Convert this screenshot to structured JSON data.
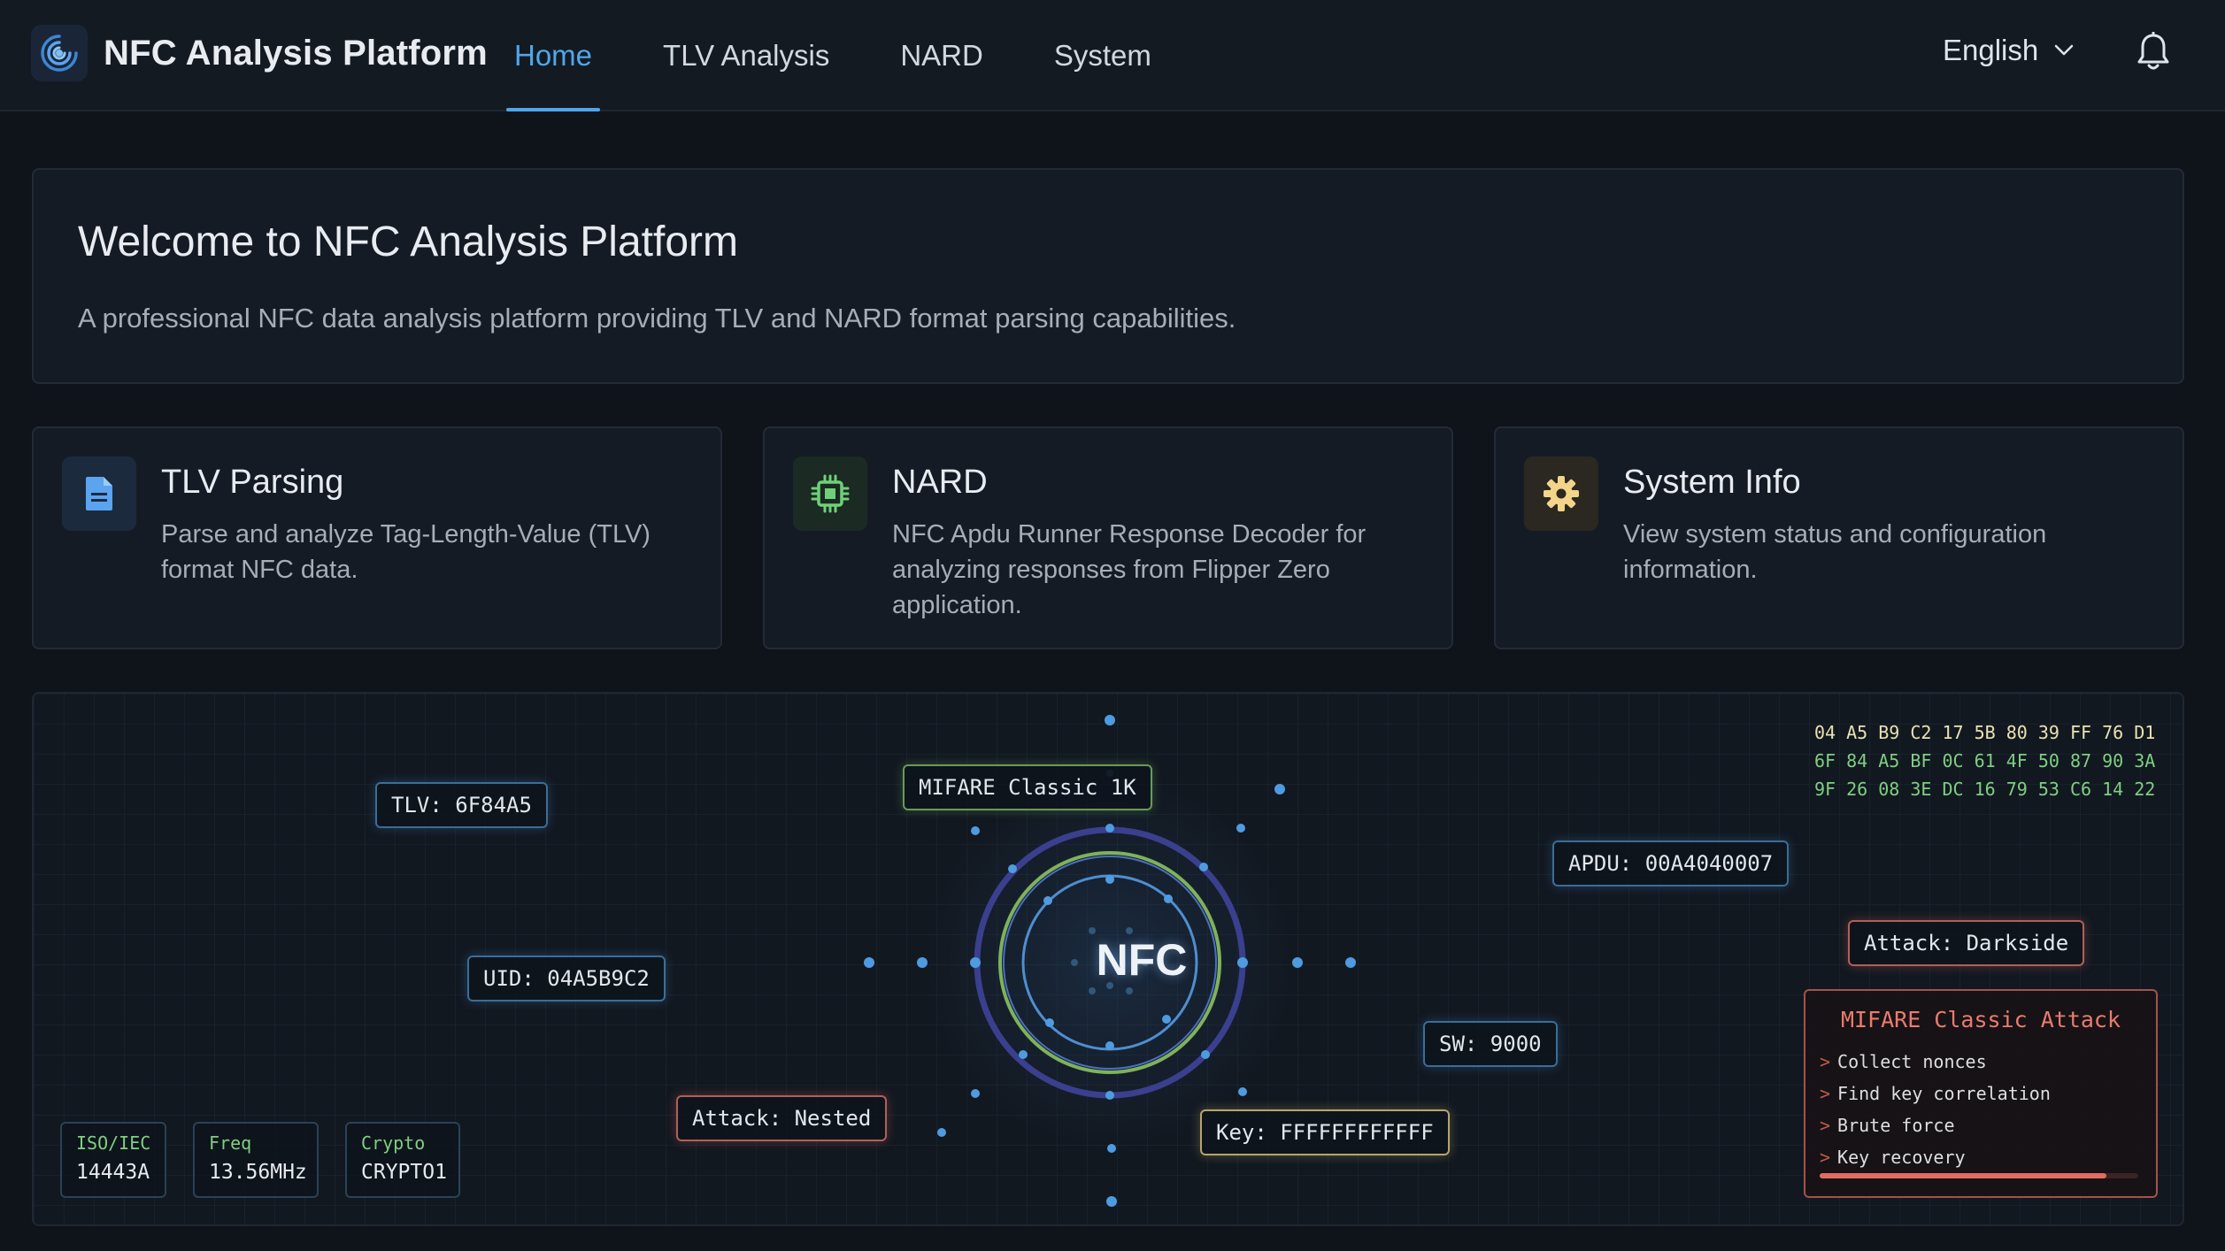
{
  "header": {
    "app_title": "NFC Analysis Platform",
    "nav": [
      {
        "label": "Home",
        "active": true
      },
      {
        "label": "TLV Analysis",
        "active": false
      },
      {
        "label": "NARD",
        "active": false
      },
      {
        "label": "System",
        "active": false
      }
    ],
    "language": "English",
    "icons": {
      "logo": "nfc-signal-icon",
      "language": "chevron-down-icon",
      "notifications": "bell-icon"
    }
  },
  "welcome": {
    "title": "Welcome to NFC Analysis Platform",
    "subtitle": "A professional NFC data analysis platform providing TLV and NARD format parsing capabilities."
  },
  "cards": [
    {
      "title": "TLV Parsing",
      "description": "Parse and analyze Tag-Length-Value (TLV) format NFC data.",
      "icon": "document-icon",
      "accent": "#5aa4f0"
    },
    {
      "title": "NARD",
      "description": "NFC Apdu Runner Response Decoder for analyzing responses from Flipper Zero application.",
      "icon": "chip-icon",
      "accent": "#6fd07a"
    },
    {
      "title": "System Info",
      "description": "View system status and configuration information.",
      "icon": "gear-icon",
      "accent": "#f2d58a"
    }
  ],
  "visualization": {
    "center_label": "NFC",
    "tags": {
      "tlv": "TLV: 6F84A5",
      "uid": "UID: 04A5B9C2",
      "mifare": "MIFARE Classic 1K",
      "apdu": "APDU: 00A4040007",
      "darkside": "Attack: Darkside",
      "nested": "Attack: Nested",
      "sw": "SW: 9000",
      "key": "Key: FFFFFFFFFFFF"
    },
    "hex_rows": [
      "04 A5 B9 C2 17 5B 80 39 FF 76 D1",
      "6F 84 A5 BF 0C 61 4F 50 87 90 3A",
      "9F 26 08 3E DC 16 79 53 C6 14 22"
    ],
    "specs": [
      {
        "key": "ISO/IEC",
        "value": "14443A"
      },
      {
        "key": "Freq",
        "value": "13.56MHz"
      },
      {
        "key": "Crypto",
        "value": "CRYPTO1"
      }
    ],
    "attack_panel": {
      "title": "MIFARE Classic Attack",
      "steps": [
        "Collect nonces",
        "Find key correlation",
        "Brute force",
        "Key recovery"
      ],
      "progress_fraction": 0.9
    },
    "colors": {
      "accent_blue": "#4fa7ea",
      "green": "#7fcf82",
      "red": "#e46a62"
    }
  }
}
